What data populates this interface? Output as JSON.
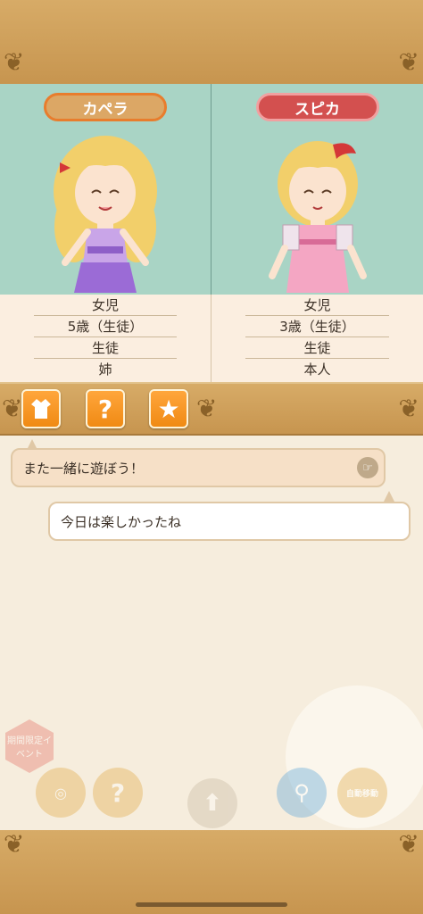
{
  "characters": [
    {
      "name": "カペラ",
      "info": [
        "女児",
        "5歳（生徒）",
        "生徒",
        "姉"
      ]
    },
    {
      "name": "スピカ",
      "info": [
        "女児",
        "3歳（生徒）",
        "生徒",
        "本人"
      ]
    }
  ],
  "tabs": [
    {
      "icon": "dress-icon"
    },
    {
      "icon": "question-icon"
    },
    {
      "icon": "star-icon"
    }
  ],
  "chat": {
    "message_1": "また一緒に遊ぼう！",
    "message_2": "今日は楽しかったね"
  },
  "bottom_menu": {
    "event_label": "期間限定イベント",
    "auto_label": "自動移動"
  },
  "colors": {
    "frame": "#c99a55",
    "panel_bg": "#a9d4c5",
    "capella_tag": "#dca765",
    "spica_tag": "#d3504f",
    "tab_button": "#f08a14"
  }
}
